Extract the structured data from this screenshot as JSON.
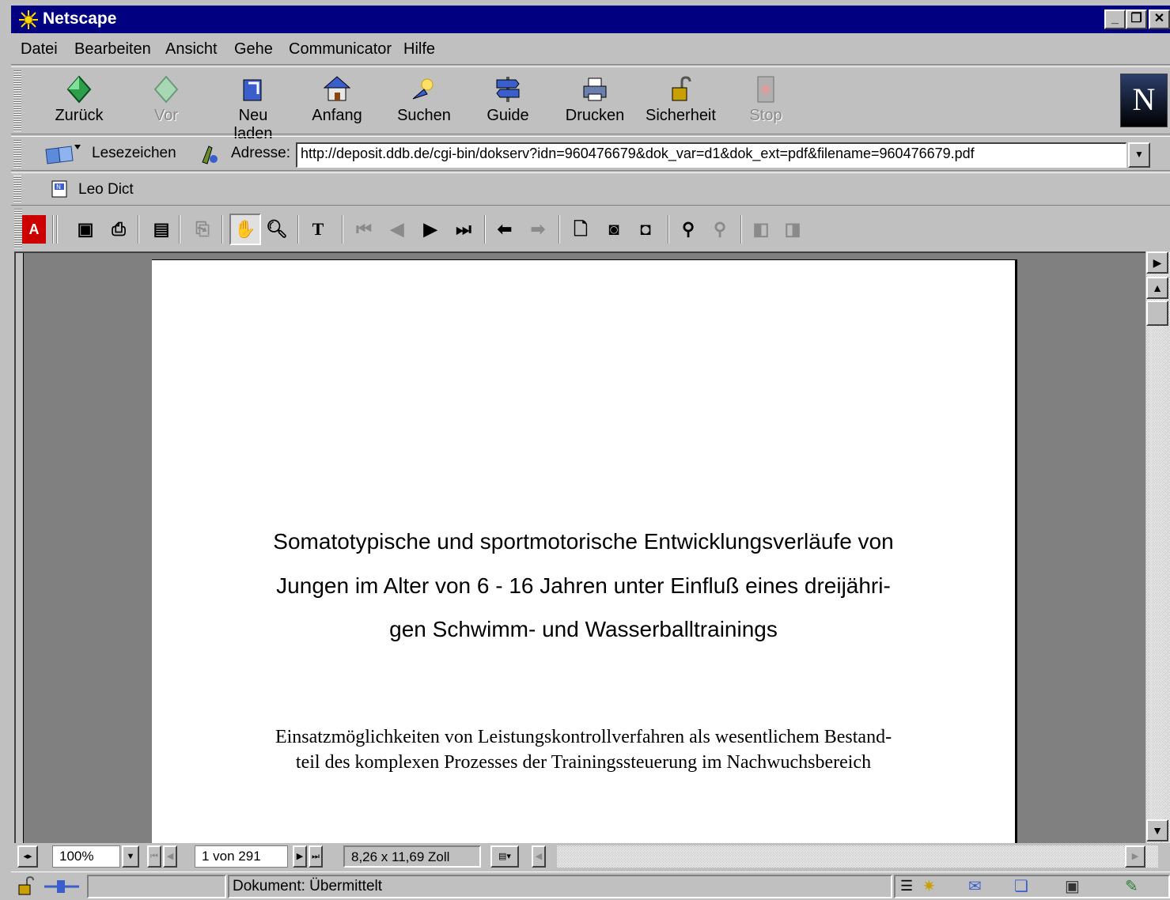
{
  "window": {
    "title": "Netscape"
  },
  "menu": [
    "Datei",
    "Bearbeiten",
    "Ansicht",
    "Gehe",
    "Communicator",
    "Hilfe"
  ],
  "nav": {
    "back": "Zurück",
    "forward": "Vor",
    "reload": "Neu laden",
    "home": "Anfang",
    "search": "Suchen",
    "guide": "Guide",
    "print": "Drucken",
    "security": "Sicherheit",
    "stop": "Stop"
  },
  "location": {
    "bookmarks": "Lesezeichen",
    "address_label": "Adresse:",
    "url": "http://deposit.ddb.de/cgi-bin/dokserv?idn=960476679&dok_var=d1&dok_ext=pdf&filename=960476679.pdf"
  },
  "personal": {
    "item": "Leo Dict"
  },
  "document": {
    "title_lines": [
      "Somatotypische und sportmotorische Entwicklungsverläufe von",
      "Jungen im Alter von 6 - 16 Jahren unter Einfluß eines dreijähri-",
      "gen Schwimm- und Wasserballtrainings"
    ],
    "subtitle_lines": [
      "Einsatzmöglichkeiten von Leistungskontrollverfahren als wesentlichem Bestand-",
      "teil des komplexen Prozesses der Trainingssteuerung im Nachwuchsbereich"
    ]
  },
  "viewer": {
    "zoom": "100%",
    "page": "1 von 291",
    "page_size": "8,26 x 11,69 Zoll"
  },
  "status": {
    "text": "Dokument: Übermittelt"
  }
}
